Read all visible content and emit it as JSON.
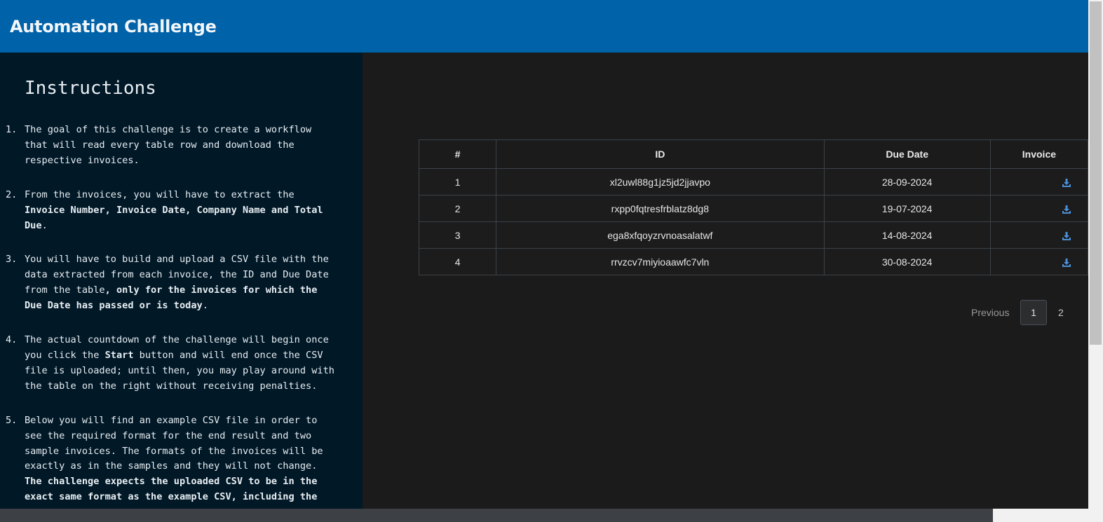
{
  "app": {
    "title": "Automation Challenge"
  },
  "sidebar": {
    "heading": "Instructions",
    "steps": [
      {
        "num": "1.",
        "parts": [
          {
            "t": "The goal of this challenge is to create a workflow\nthat will read every table row and download the\nrespective invoices.",
            "b": false
          }
        ]
      },
      {
        "num": "2.",
        "parts": [
          {
            "t": "From the invoices, you will have to extract the\n",
            "b": false
          },
          {
            "t": "Invoice Number, Invoice Date, Company Name and Total\nDue",
            "b": true
          },
          {
            "t": ".",
            "b": false
          }
        ]
      },
      {
        "num": "3.",
        "parts": [
          {
            "t": "You will have to build and upload a CSV file with the\ndata extracted from each invoice, the ID and Due Date\nfrom the table",
            "b": false
          },
          {
            "t": ", only for the invoices for which the\nDue Date has passed or is today",
            "b": true
          },
          {
            "t": ".",
            "b": false
          }
        ]
      },
      {
        "num": "4.",
        "parts": [
          {
            "t": "The actual countdown of the challenge will begin once\nyou click the ",
            "b": false
          },
          {
            "t": "Start",
            "b": true
          },
          {
            "t": " button and will end once the CSV\nfile is uploaded; until then, you may play around with\nthe table on the right without receiving penalties.",
            "b": false
          }
        ]
      },
      {
        "num": "5.",
        "parts": [
          {
            "t": "Below you will find an example CSV file in order to\nsee the required format for the end result and two\nsample invoices. The formats of the invoices will be\nexactly as in the samples and they will not change.\n",
            "b": false
          },
          {
            "t": "The challenge expects the uploaded CSV to be in the\nexact same format as the example CSV, including the",
            "b": true
          }
        ]
      }
    ]
  },
  "table": {
    "headers": {
      "num": "#",
      "id": "ID",
      "due": "Due Date",
      "invoice": "Invoice"
    },
    "rows": [
      {
        "num": "1",
        "id": "xl2uwl88g1jz5jd2jjavpo",
        "due": "28-09-2024",
        "icon": "download-icon"
      },
      {
        "num": "2",
        "id": "rxpp0fqtresfrblatz8dg8",
        "due": "19-07-2024",
        "icon": "download-icon"
      },
      {
        "num": "3",
        "id": "ega8xfqoyzrvnoasalatwf",
        "due": "14-08-2024",
        "icon": "download-icon"
      },
      {
        "num": "4",
        "id": "rrvzcv7miyioaawfc7vln",
        "due": "30-08-2024",
        "icon": "download-icon"
      }
    ]
  },
  "pagination": {
    "previous": "Previous",
    "pages": [
      "1",
      "2"
    ],
    "current": "1"
  },
  "colors": {
    "navbar": "#0062a8",
    "sidebar": "#011827",
    "main": "#1b1b1b",
    "download_icon": "#4a90d9"
  }
}
